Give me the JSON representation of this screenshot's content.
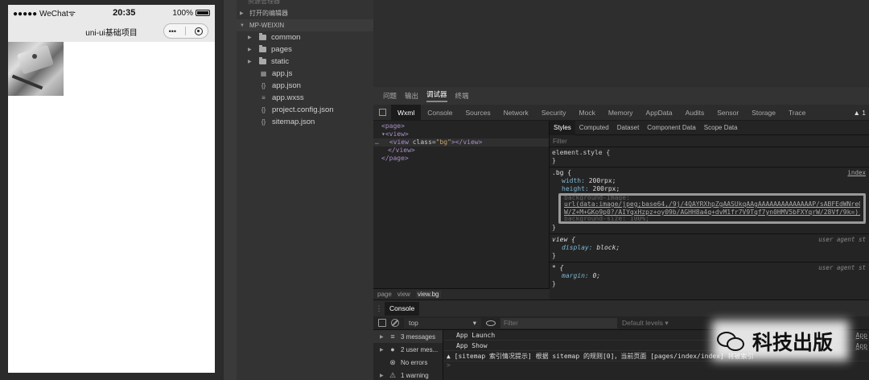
{
  "simulator": {
    "carrier": "●●●●● WeChat",
    "wifi": "ᯤ",
    "time": "20:35",
    "battery": "100%",
    "nav_title": "uni-ui基础项目",
    "capsule_more": "•••"
  },
  "explorer": {
    "header": "资源管理器",
    "open_editors": "打开的编辑器",
    "project": "MP-WEIXIN",
    "items": [
      {
        "name": "common",
        "type": "folder"
      },
      {
        "name": "pages",
        "type": "folder"
      },
      {
        "name": "static",
        "type": "folder"
      },
      {
        "name": "app.js",
        "type": "js"
      },
      {
        "name": "app.json",
        "type": "json"
      },
      {
        "name": "app.wxss",
        "type": "wxss"
      },
      {
        "name": "project.config.json",
        "type": "json"
      },
      {
        "name": "sitemap.json",
        "type": "json"
      }
    ]
  },
  "devtools": {
    "top_tabs": [
      "问题",
      "输出",
      "调试器",
      "终端"
    ],
    "panel_tabs": [
      "Wxml",
      "Console",
      "Sources",
      "Network",
      "Security",
      "Mock",
      "Memory",
      "AppData",
      "Audits",
      "Sensor",
      "Storage",
      "Trace"
    ],
    "warn_marker": "▲ 1",
    "wxml": {
      "l1": "<page>",
      "l2": "▾<view>",
      "l3_dots": "…",
      "l3_open": "<view ",
      "l3_attr": "class=",
      "l3_val": "\"bg\"",
      "l3_close": "></view>",
      "l4": "</view>",
      "l5": "</page>"
    },
    "breadcrumb": [
      "page",
      "view",
      "view.bg"
    ],
    "styles_tabs": [
      "Styles",
      "Computed",
      "Dataset",
      "Component Data",
      "Scope Data"
    ],
    "filter_placeholder": "Filter",
    "rules": {
      "element_style": "element.style {",
      "close": "}",
      "bg_selector": ".bg {",
      "bg_source": "index",
      "width_prop": "width:",
      "width_val": "200rpx;",
      "height_prop": "height:",
      "height_val": "200rpx;",
      "bgimg_prop": "background-image:",
      "url_line1": "url(data:image/jpeg;base64,/9j/4QAYRXhpZgAASUkqAAgAAAAAAAAAAAAAAP/sABFEdWNreQAB...",
      "url_line2": "W/Z+M+GKo9p0?/AIYqxHzpz+oy09b/AGHH8a4q+dvM1fr7V9Tqf7yn0HMV5bFXYqrW/28Vf/9k=);",
      "bgsize_line": "background-size: 100%;",
      "view_selector": "view {",
      "view_source": "user agent st",
      "display_prop": "display:",
      "display_val": "block;",
      "star_selector": "* {",
      "star_source": "user agent st",
      "margin_prop": "margin:",
      "margin_val": "0;"
    },
    "console": {
      "tab": "Console",
      "context": "top",
      "filter_placeholder": "Filter",
      "levels": "Default levels ▾",
      "sidebar": [
        {
          "icon": "≡",
          "label": "3 messages"
        },
        {
          "icon": "●",
          "label": "2 user mes..."
        },
        {
          "icon": "⊗",
          "label": "No errors"
        },
        {
          "icon": "⚠",
          "label": "1 warning"
        }
      ],
      "logs": [
        "App Launch",
        "App Show",
        "▲ [sitemap 索引情况提示] 根据 sitemap 的规则[0]，当前页面 [pages/index/index] 将被索引"
      ],
      "log_source": "App",
      "prompt": ">"
    }
  },
  "watermark": {
    "text": "科技出版"
  }
}
